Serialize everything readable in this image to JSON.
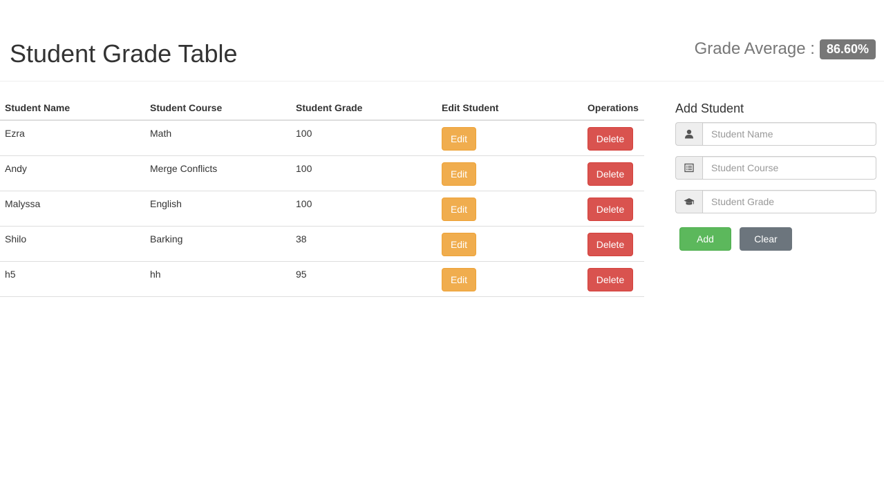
{
  "header": {
    "title": "Student Grade Table",
    "average_label": "Grade Average :",
    "average_value": "86.60%"
  },
  "table": {
    "columns": [
      "Student Name",
      "Student Course",
      "Student Grade",
      "Edit Student",
      "Operations"
    ],
    "rows": [
      {
        "name": "Ezra",
        "course": "Math",
        "grade": "100",
        "edit_label": "Edit",
        "delete_label": "Delete"
      },
      {
        "name": "Andy",
        "course": "Merge Conflicts",
        "grade": "100",
        "edit_label": "Edit",
        "delete_label": "Delete"
      },
      {
        "name": "Malyssa",
        "course": "English",
        "grade": "100",
        "edit_label": "Edit",
        "delete_label": "Delete"
      },
      {
        "name": "Shilo",
        "course": "Barking",
        "grade": "38",
        "edit_label": "Edit",
        "delete_label": "Delete"
      },
      {
        "name": "h5",
        "course": "hh",
        "grade": "95",
        "edit_label": "Edit",
        "delete_label": "Delete"
      }
    ]
  },
  "add_form": {
    "title": "Add Student",
    "name_placeholder": "Student Name",
    "course_placeholder": "Student Course",
    "grade_placeholder": "Student Grade",
    "name_value": "",
    "course_value": "",
    "grade_value": "",
    "name_icon": "user-icon",
    "course_icon": "list-alt-icon",
    "grade_icon": "graduation-cap-icon",
    "add_label": "Add",
    "clear_label": "Clear"
  },
  "colors": {
    "edit": "#f0ad4e",
    "delete": "#d9534f",
    "add": "#5cb85c",
    "clear": "#6c757d",
    "badge": "#777777"
  }
}
